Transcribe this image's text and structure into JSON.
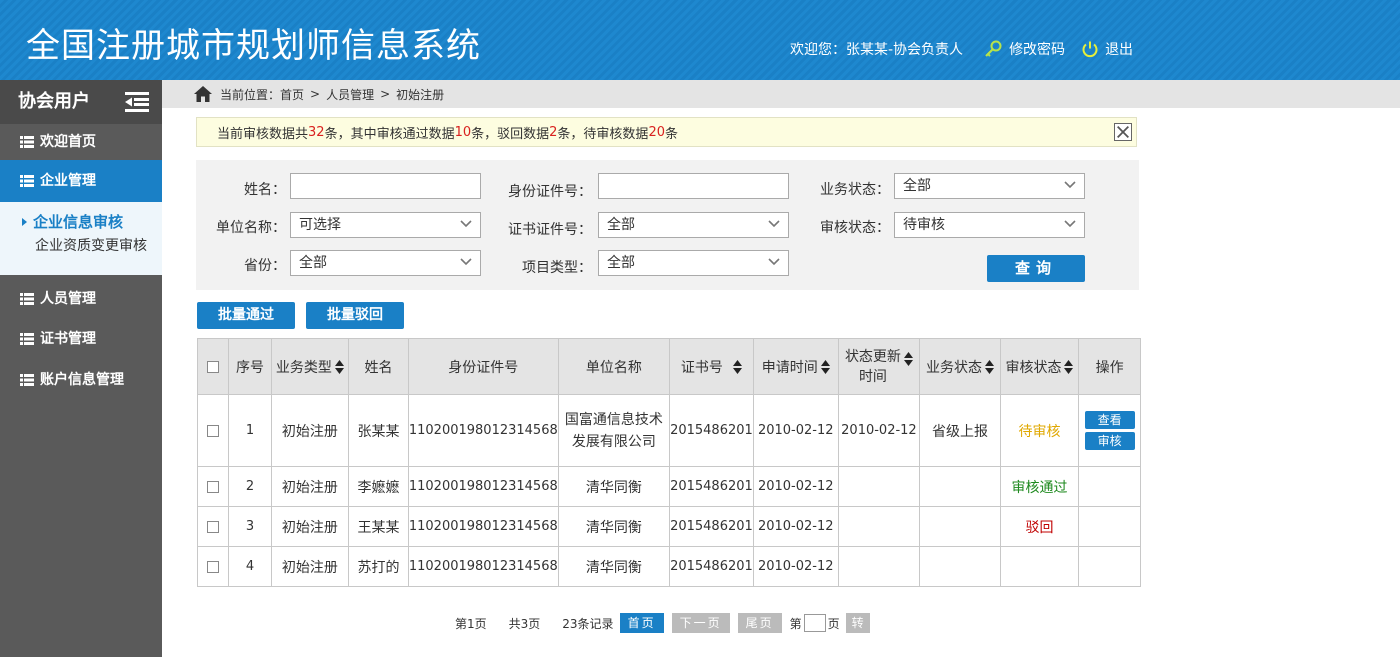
{
  "header": {
    "title": "全国注册城市规划师信息系统",
    "welcome": "欢迎您：张某某-协会负责人",
    "change_password": "修改密码",
    "logout": "退出"
  },
  "sidebar": {
    "title": "协会用户",
    "items": [
      {
        "label": "欢迎首页"
      },
      {
        "label": "企业管理"
      },
      {
        "label": "人员管理"
      },
      {
        "label": "证书管理"
      },
      {
        "label": "账户信息管理"
      }
    ],
    "sub_items": [
      {
        "label": "企业信息审核"
      },
      {
        "label": "企业资质变更审核"
      }
    ]
  },
  "breadcrumb": {
    "prefix": "当前位置：",
    "items": [
      "首页",
      "人员管理",
      "初始注册"
    ]
  },
  "notice": {
    "p1": "当前审核数据共",
    "total": "32",
    "p2": "条，其中审核通过数据",
    "passed": "10",
    "p3": "条，驳回数据",
    "rejected": "2",
    "p4": "条，待审核数据",
    "pending": "20",
    "p5": "条"
  },
  "search": {
    "name_label": "姓名：",
    "name_value": "",
    "id_label": "身份证件号：",
    "id_value": "",
    "biz_status_label": "业务状态：",
    "biz_status_value": "全部",
    "unit_label": "单位名称：",
    "unit_value": "可选择",
    "cert_label": "证书证件号：",
    "cert_value": "全部",
    "audit_status_label": "审核状态：",
    "audit_status_value": "待审核",
    "province_label": "省份：",
    "province_value": "全部",
    "project_label": "项目类型：",
    "project_value": "全部",
    "query_button": "查询"
  },
  "actions": {
    "batch_pass": "批量通过",
    "batch_reject": "批量驳回"
  },
  "table": {
    "headers": {
      "seq": "序号",
      "biz_type": "业务类型",
      "name": "姓名",
      "id_no": "身份证件号",
      "unit": "单位名称",
      "cert_no": "证书号",
      "apply_time": "申请时间",
      "status_update_1": "状态更新",
      "status_update_2": "时间",
      "biz_status": "业务状态",
      "audit_status": "审核状态",
      "ops": "操作"
    },
    "rows": [
      {
        "seq": "1",
        "biz_type": "初始注册",
        "name": "张某某",
        "id_no": "110200198012314568",
        "unit_1": "国富通信息技术",
        "unit_2": "发展有限公司",
        "cert_no": "2015486201",
        "apply_time": "2010-02-12",
        "status_update": "2010-02-12",
        "biz_status": "省级上报",
        "audit_status": "待审核",
        "op_view": "查看",
        "op_audit": "审核"
      },
      {
        "seq": "2",
        "biz_type": "初始注册",
        "name": "李嬷嬷",
        "id_no": "110200198012314568",
        "unit": "清华同衡",
        "cert_no": "2015486201",
        "apply_time": "2010-02-12",
        "status_update": "",
        "biz_status": "",
        "audit_status": "审核通过"
      },
      {
        "seq": "3",
        "biz_type": "初始注册",
        "name": "王某某",
        "id_no": "110200198012314568",
        "unit": "清华同衡",
        "cert_no": "2015486201",
        "apply_time": "2010-02-12",
        "status_update": "",
        "biz_status": "",
        "audit_status": "驳回"
      },
      {
        "seq": "4",
        "biz_type": "初始注册",
        "name": "苏打的",
        "id_no": "110200198012314568",
        "unit": "清华同衡",
        "cert_no": "2015486201",
        "apply_time": "2010-02-12",
        "status_update": "",
        "biz_status": "",
        "audit_status": ""
      }
    ]
  },
  "pagination": {
    "current": "第1页",
    "total_pages": "共3页",
    "records": "23条记录",
    "first": "首页",
    "next": "下一页",
    "last": "尾页",
    "goto_prefix": "第",
    "goto_suffix": "页",
    "go": "转"
  },
  "colors": {
    "brand_blue": "#1a80c6",
    "sidebar_gray": "#5a5a5a",
    "pending": "#e0a800",
    "pass": "#1f8a1f",
    "reject": "#c00000",
    "highlight_num": "#d9221f"
  }
}
